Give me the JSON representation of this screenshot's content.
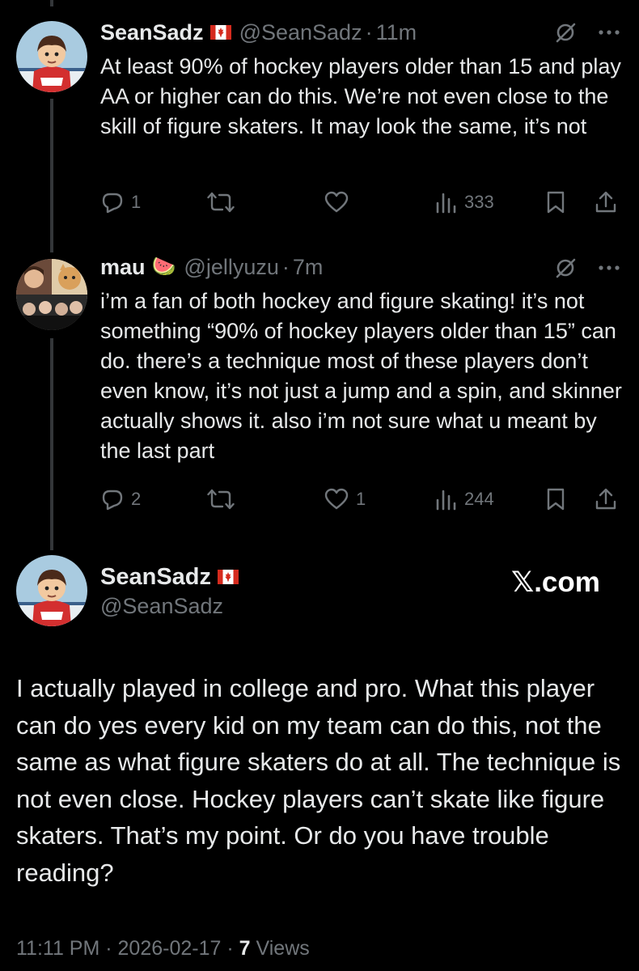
{
  "thread": [
    {
      "name": "SeanSadz",
      "handle": "@SeanSadz",
      "time": "11m",
      "text": "At least 90% of hockey players older than 15 and play AA or higher can do this. We’re not even close to the skill of figure skaters. It may look the same, it’s not",
      "replies": "1",
      "reposts": "",
      "likes": "",
      "views": "333"
    },
    {
      "name": "mau",
      "name_emoji": "🍉",
      "handle": "@jellyuzu",
      "time": "7m",
      "text": "i’m a fan of both hockey and figure skating! it’s not something “90% of hockey players older than 15” can do. there’s a technique most of these players don’t even know, it’s not just a jump and a spin, and skinner actually shows it. also i’m not sure what u meant by the last part",
      "replies": "2",
      "reposts": "",
      "likes": "1",
      "views": "244"
    }
  ],
  "focus_tweet": {
    "name": "SeanSadz",
    "handle": "@SeanSadz",
    "text": "I actually played in college and pro. What this player can do yes every kid on my team can do this, not the same as what figure skaters do at all. The technique is not even close. Hockey players can’t skate like figure skaters. That’s my point. Or do you have trouble reading?",
    "time": "11:11 PM",
    "date": "2026-02-17",
    "views_count": "7",
    "views_label": "Views"
  },
  "watermark": {
    "logo": "𝕏",
    "text": ".com"
  },
  "meta_sep": "·",
  "icons": [
    "canada-flag-icon",
    "grok-icon",
    "more-icon",
    "reply-icon",
    "repost-icon",
    "like-icon",
    "views-icon",
    "bookmark-icon",
    "share-icon"
  ],
  "colors": {
    "background": "#000000",
    "text": "#e7e9ea",
    "secondary": "#71767b",
    "line": "#333639",
    "flag_red": "#d52b1e"
  }
}
